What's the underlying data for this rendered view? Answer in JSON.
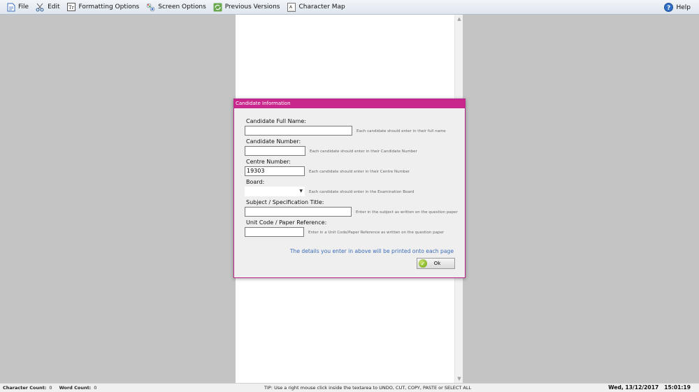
{
  "toolbar": {
    "items": [
      {
        "label": "File",
        "icon": "file-icon"
      },
      {
        "label": "Edit",
        "icon": "scissors-icon"
      },
      {
        "label": "Formatting Options",
        "icon": "text-format-icon"
      },
      {
        "label": "Screen Options",
        "icon": "palette-icon"
      },
      {
        "label": "Previous Versions",
        "icon": "recycle-icon"
      },
      {
        "label": "Character Map",
        "icon": "character-map-icon"
      }
    ],
    "help_label": "Help"
  },
  "dialog": {
    "title": "Candidate Information",
    "fields": {
      "full_name": {
        "label": "Candidate Full Name:",
        "value": "",
        "hint": "Each candidate should enter in their full name"
      },
      "number": {
        "label": "Candidate Number:",
        "value": "",
        "hint": "Each candidate should enter in their Candidate Number"
      },
      "centre": {
        "label": "Centre Number:",
        "value": "19303",
        "hint": "Each candidate should enter in their Centre Number"
      },
      "board": {
        "label": "Board:",
        "value": "",
        "hint": "Each candidate should enter in the Examination Board"
      },
      "subject": {
        "label": "Subject / Specification Title:",
        "value": "",
        "hint": "Enter in the subject as written on the question paper"
      },
      "unit_code": {
        "label": "Unit Code / Paper Reference:",
        "value": "",
        "hint": "Enter in a Unit Code/Paper Reference as written on the question paper"
      }
    },
    "note": "The details you enter in above will be printed onto each page",
    "ok_label": "Ok"
  },
  "statusbar": {
    "char_count_label": "Character Count:",
    "char_count": "0",
    "word_count_label": "Word Count:",
    "word_count": "0",
    "tip": "TIP: Use a right mouse click inside the textarea to UNDO, CUT, COPY, PASTE or SELECT ALL",
    "datetime": "Wed, 13/12/2017   15:01:19"
  },
  "colors": {
    "dialog_titlebar": "#c8288c",
    "note_text": "#3b6bb6",
    "workspace": "#c4c4c4"
  }
}
